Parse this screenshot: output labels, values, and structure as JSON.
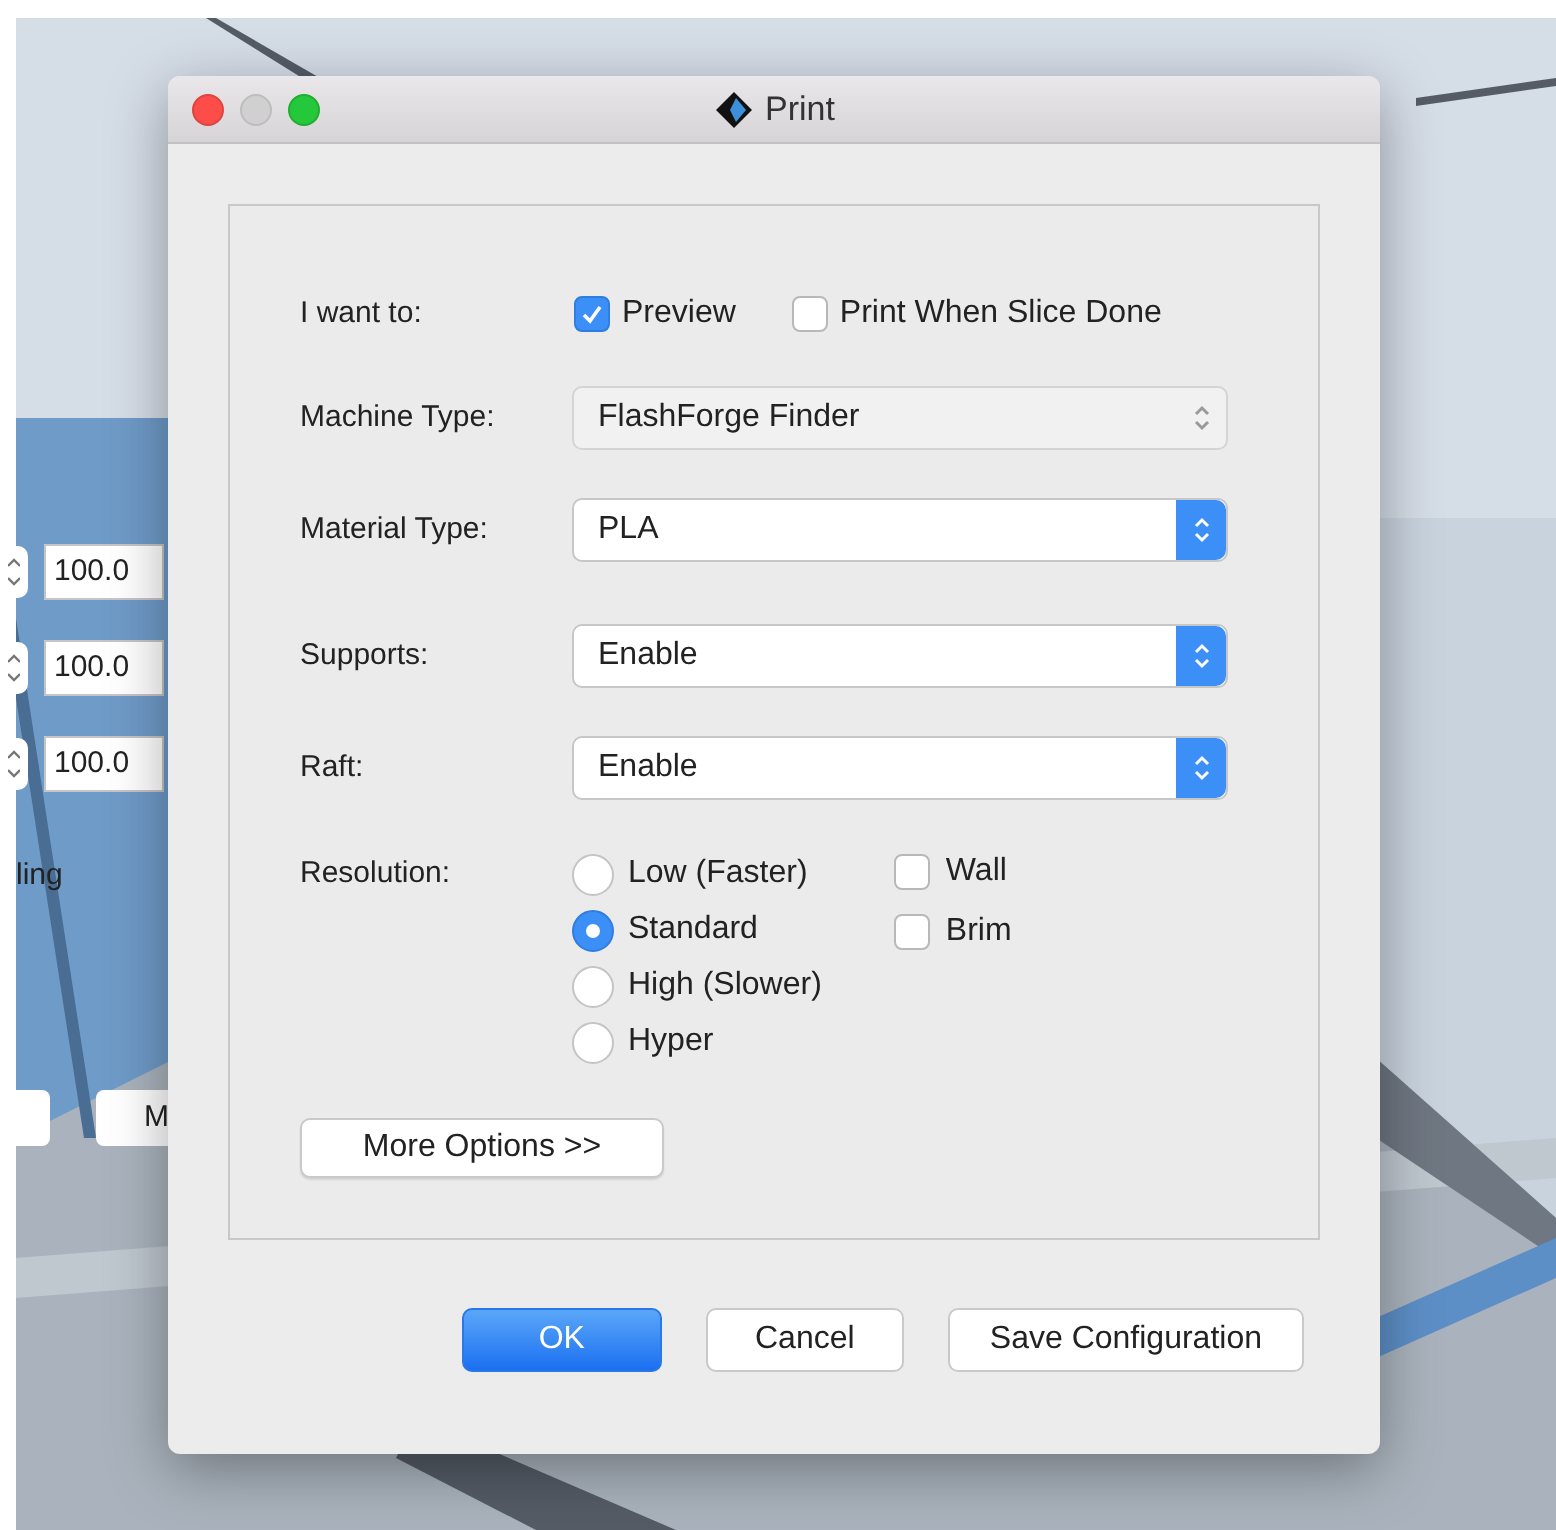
{
  "background": {
    "fields": [
      "100.0",
      "100.0",
      "100.0"
    ],
    "label": "ling",
    "buttons": [
      "M"
    ]
  },
  "window": {
    "title": "Print"
  },
  "want": {
    "label": "I want to:",
    "options": [
      {
        "label": "Preview",
        "checked": true
      },
      {
        "label": "Print When Slice Done",
        "checked": false
      }
    ]
  },
  "selects": [
    {
      "label": "Machine Type:",
      "value": "FlashForge Finder",
      "disabled": true
    },
    {
      "label": "Material Type:",
      "value": "PLA",
      "disabled": false
    },
    {
      "label": "Supports:",
      "value": "Enable",
      "disabled": false
    },
    {
      "label": "Raft:",
      "value": "Enable",
      "disabled": false
    }
  ],
  "resolution": {
    "label": "Resolution:",
    "options": [
      {
        "label": "Low (Faster)",
        "selected": false
      },
      {
        "label": "Standard",
        "selected": true
      },
      {
        "label": "High (Slower)",
        "selected": false
      },
      {
        "label": "Hyper",
        "selected": false
      }
    ],
    "extras": [
      {
        "label": "Wall",
        "checked": false
      },
      {
        "label": "Brim",
        "checked": false
      }
    ]
  },
  "more_options": "More Options >>",
  "buttons": [
    {
      "label": "OK",
      "default": true
    },
    {
      "label": "Cancel",
      "default": false
    },
    {
      "label": "Save Configuration",
      "default": false
    }
  ]
}
